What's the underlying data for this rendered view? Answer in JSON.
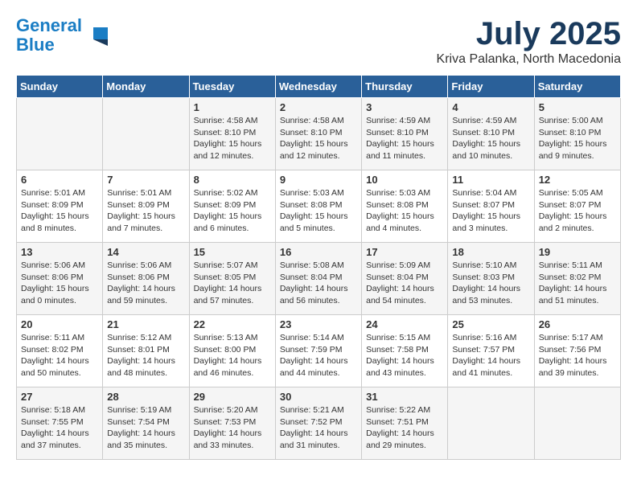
{
  "header": {
    "logo_line1": "General",
    "logo_line2": "Blue",
    "month": "July 2025",
    "location": "Kriva Palanka, North Macedonia"
  },
  "days_of_week": [
    "Sunday",
    "Monday",
    "Tuesday",
    "Wednesday",
    "Thursday",
    "Friday",
    "Saturday"
  ],
  "weeks": [
    [
      {
        "day": "",
        "info": ""
      },
      {
        "day": "",
        "info": ""
      },
      {
        "day": "1",
        "info": "Sunrise: 4:58 AM\nSunset: 8:10 PM\nDaylight: 15 hours and 12 minutes."
      },
      {
        "day": "2",
        "info": "Sunrise: 4:58 AM\nSunset: 8:10 PM\nDaylight: 15 hours and 12 minutes."
      },
      {
        "day": "3",
        "info": "Sunrise: 4:59 AM\nSunset: 8:10 PM\nDaylight: 15 hours and 11 minutes."
      },
      {
        "day": "4",
        "info": "Sunrise: 4:59 AM\nSunset: 8:10 PM\nDaylight: 15 hours and 10 minutes."
      },
      {
        "day": "5",
        "info": "Sunrise: 5:00 AM\nSunset: 8:10 PM\nDaylight: 15 hours and 9 minutes."
      }
    ],
    [
      {
        "day": "6",
        "info": "Sunrise: 5:01 AM\nSunset: 8:09 PM\nDaylight: 15 hours and 8 minutes."
      },
      {
        "day": "7",
        "info": "Sunrise: 5:01 AM\nSunset: 8:09 PM\nDaylight: 15 hours and 7 minutes."
      },
      {
        "day": "8",
        "info": "Sunrise: 5:02 AM\nSunset: 8:09 PM\nDaylight: 15 hours and 6 minutes."
      },
      {
        "day": "9",
        "info": "Sunrise: 5:03 AM\nSunset: 8:08 PM\nDaylight: 15 hours and 5 minutes."
      },
      {
        "day": "10",
        "info": "Sunrise: 5:03 AM\nSunset: 8:08 PM\nDaylight: 15 hours and 4 minutes."
      },
      {
        "day": "11",
        "info": "Sunrise: 5:04 AM\nSunset: 8:07 PM\nDaylight: 15 hours and 3 minutes."
      },
      {
        "day": "12",
        "info": "Sunrise: 5:05 AM\nSunset: 8:07 PM\nDaylight: 15 hours and 2 minutes."
      }
    ],
    [
      {
        "day": "13",
        "info": "Sunrise: 5:06 AM\nSunset: 8:06 PM\nDaylight: 15 hours and 0 minutes."
      },
      {
        "day": "14",
        "info": "Sunrise: 5:06 AM\nSunset: 8:06 PM\nDaylight: 14 hours and 59 minutes."
      },
      {
        "day": "15",
        "info": "Sunrise: 5:07 AM\nSunset: 8:05 PM\nDaylight: 14 hours and 57 minutes."
      },
      {
        "day": "16",
        "info": "Sunrise: 5:08 AM\nSunset: 8:04 PM\nDaylight: 14 hours and 56 minutes."
      },
      {
        "day": "17",
        "info": "Sunrise: 5:09 AM\nSunset: 8:04 PM\nDaylight: 14 hours and 54 minutes."
      },
      {
        "day": "18",
        "info": "Sunrise: 5:10 AM\nSunset: 8:03 PM\nDaylight: 14 hours and 53 minutes."
      },
      {
        "day": "19",
        "info": "Sunrise: 5:11 AM\nSunset: 8:02 PM\nDaylight: 14 hours and 51 minutes."
      }
    ],
    [
      {
        "day": "20",
        "info": "Sunrise: 5:11 AM\nSunset: 8:02 PM\nDaylight: 14 hours and 50 minutes."
      },
      {
        "day": "21",
        "info": "Sunrise: 5:12 AM\nSunset: 8:01 PM\nDaylight: 14 hours and 48 minutes."
      },
      {
        "day": "22",
        "info": "Sunrise: 5:13 AM\nSunset: 8:00 PM\nDaylight: 14 hours and 46 minutes."
      },
      {
        "day": "23",
        "info": "Sunrise: 5:14 AM\nSunset: 7:59 PM\nDaylight: 14 hours and 44 minutes."
      },
      {
        "day": "24",
        "info": "Sunrise: 5:15 AM\nSunset: 7:58 PM\nDaylight: 14 hours and 43 minutes."
      },
      {
        "day": "25",
        "info": "Sunrise: 5:16 AM\nSunset: 7:57 PM\nDaylight: 14 hours and 41 minutes."
      },
      {
        "day": "26",
        "info": "Sunrise: 5:17 AM\nSunset: 7:56 PM\nDaylight: 14 hours and 39 minutes."
      }
    ],
    [
      {
        "day": "27",
        "info": "Sunrise: 5:18 AM\nSunset: 7:55 PM\nDaylight: 14 hours and 37 minutes."
      },
      {
        "day": "28",
        "info": "Sunrise: 5:19 AM\nSunset: 7:54 PM\nDaylight: 14 hours and 35 minutes."
      },
      {
        "day": "29",
        "info": "Sunrise: 5:20 AM\nSunset: 7:53 PM\nDaylight: 14 hours and 33 minutes."
      },
      {
        "day": "30",
        "info": "Sunrise: 5:21 AM\nSunset: 7:52 PM\nDaylight: 14 hours and 31 minutes."
      },
      {
        "day": "31",
        "info": "Sunrise: 5:22 AM\nSunset: 7:51 PM\nDaylight: 14 hours and 29 minutes."
      },
      {
        "day": "",
        "info": ""
      },
      {
        "day": "",
        "info": ""
      }
    ]
  ]
}
